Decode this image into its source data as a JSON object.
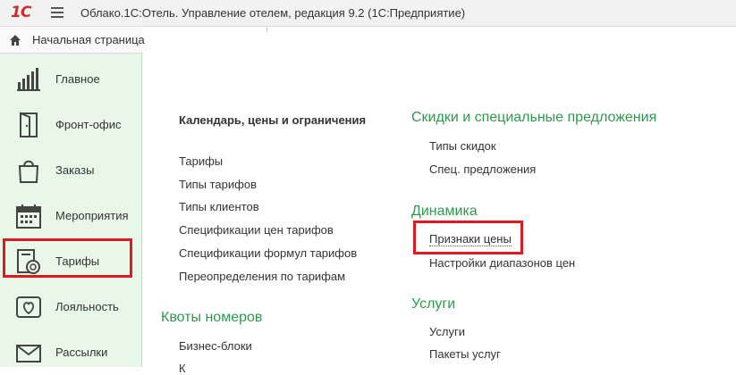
{
  "app": {
    "logo_text": "1С",
    "title": "Облако.1С:Отель. Управление отелем, редакция 9.2  (1С:Предприятие)",
    "home_label": "Начальная страница"
  },
  "sidebar": {
    "items": [
      {
        "label": "Главное",
        "icon": "bar-chart-icon"
      },
      {
        "label": "Фронт-офис",
        "icon": "door-icon"
      },
      {
        "label": "Заказы",
        "icon": "shopping-bag-icon"
      },
      {
        "label": "Мероприятия",
        "icon": "calendar-icon"
      },
      {
        "label": "Тарифы",
        "icon": "tariff-document-icon",
        "active": true
      },
      {
        "label": "Лояльность",
        "icon": "heart-icon"
      },
      {
        "label": "Рассылки",
        "icon": "envelope-icon"
      }
    ]
  },
  "content": {
    "calendar": {
      "heading": "Календарь, цены и ограничения",
      "links": [
        "Тарифы",
        "Типы тарифов",
        "Типы клиентов",
        "Спецификации цен тарифов",
        "Спецификации формул тарифов",
        "Переопределения по тарифам"
      ]
    },
    "quotas": {
      "heading": "Квоты номеров",
      "links": [
        "Бизнес-блоки",
        "К"
      ]
    },
    "discounts": {
      "heading": "Скидки и специальные предложения",
      "links": [
        "Типы скидок",
        "Спец. предложения"
      ]
    },
    "dynamics": {
      "heading": "Динамика",
      "links": [
        "Признаки цены",
        "Настройки диапазонов цен"
      ]
    },
    "services": {
      "heading": "Услуги",
      "links": [
        "Услуги",
        "Пакеты услуг"
      ]
    }
  },
  "colors": {
    "accent_green": "#2e9a4c",
    "sidebar_bg": "#e9f7e9",
    "highlight_red": "#e0191f",
    "logo_red": "#d32b2b"
  }
}
